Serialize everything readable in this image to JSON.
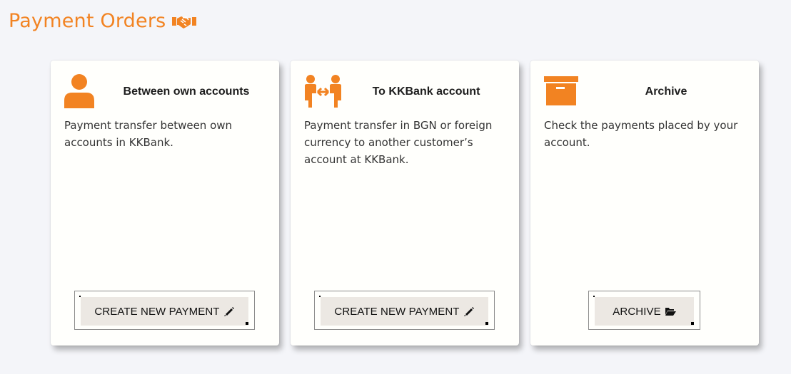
{
  "page": {
    "title": "Payment Orders"
  },
  "colors": {
    "accent": "#f28322",
    "background": "#f4f5f9",
    "card": "#fffffc",
    "button": "#ece8e3"
  },
  "cards": [
    {
      "icon": "person-icon",
      "heading": "Between own accounts",
      "description": "Payment transfer between own accounts in KKBank.",
      "button_label": "CREATE NEW PAYMENT",
      "button_icon": "pen-icon"
    },
    {
      "icon": "transfer-people-icon",
      "heading": "To KKBank account",
      "description": "Payment transfer in BGN or foreign currency to another customer’s account at KKBank.",
      "button_label": "CREATE NEW PAYMENT",
      "button_icon": "pen-icon"
    },
    {
      "icon": "archive-box-icon",
      "heading": "Archive",
      "description": "Check the payments placed by your account.",
      "button_label": "ARCHIVE",
      "button_icon": "folder-open-icon"
    }
  ]
}
